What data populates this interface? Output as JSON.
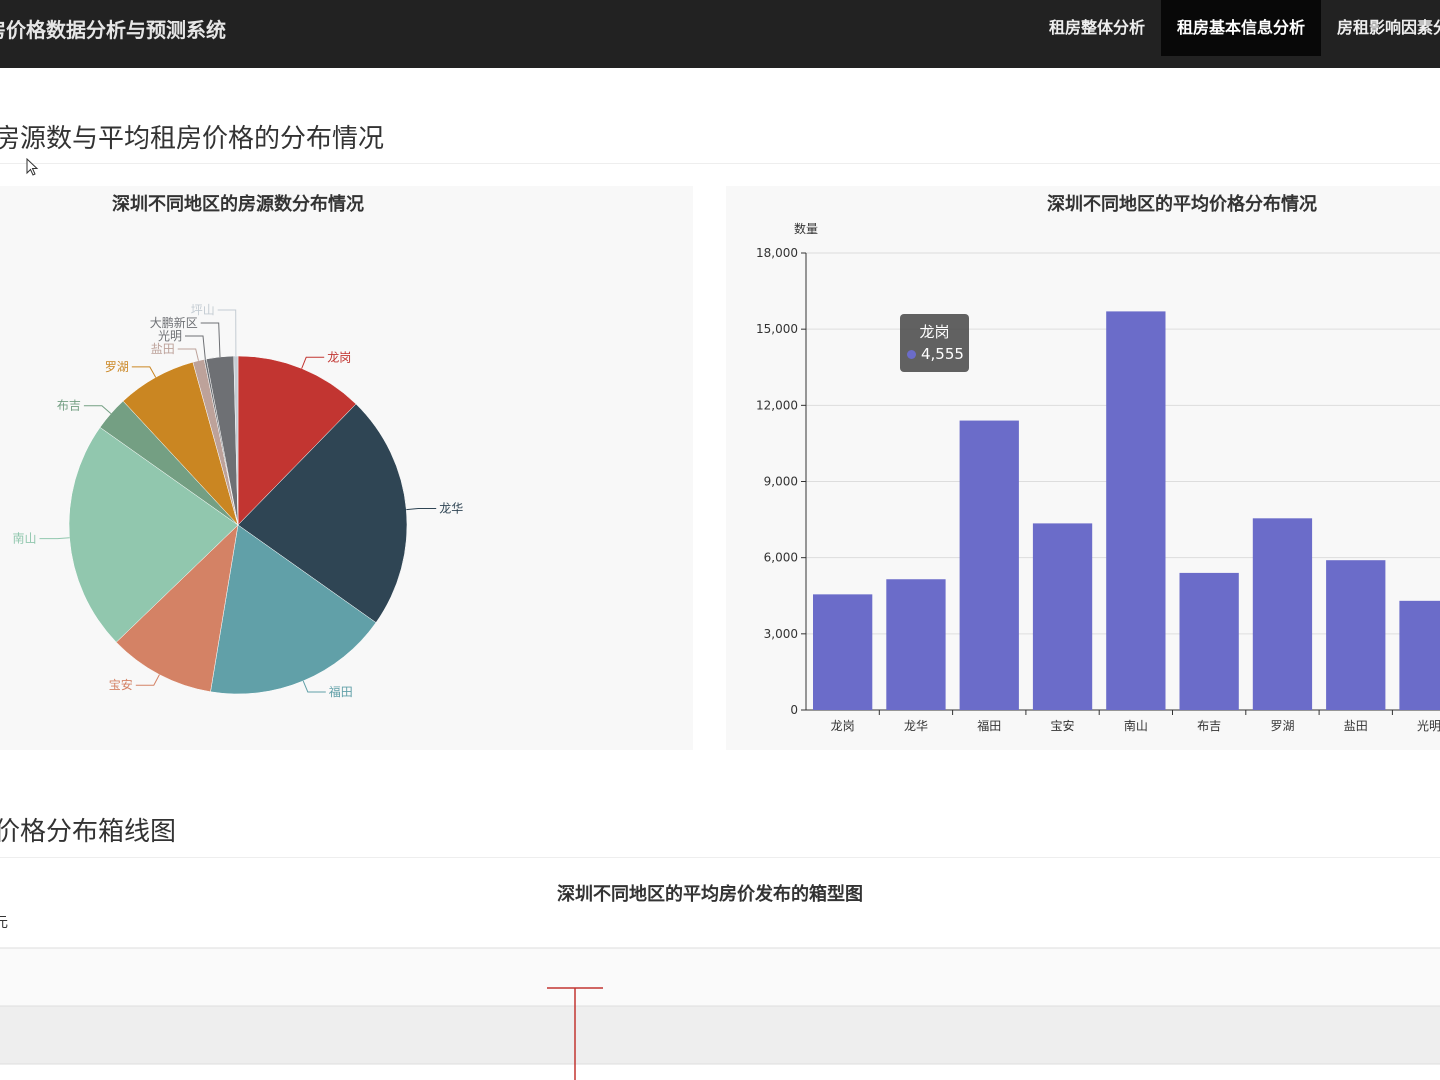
{
  "app": {
    "title": "房价格数据分析与预测系统",
    "nav": [
      {
        "label": "租房整体分析"
      },
      {
        "label": "租房基本信息分析"
      },
      {
        "label": "房租影响因素分"
      }
    ],
    "active_nav": 1
  },
  "section1": {
    "title": "房源数与平均租房价格的分布情况"
  },
  "section2": {
    "title": "价格分布箱线图"
  },
  "tooltip": {
    "name": "龙岗",
    "value": "4,555",
    "color": "#6b6cc9"
  },
  "chart_data": [
    {
      "type": "pie",
      "title": "深圳不同地区的房源数分布情况",
      "slices": [
        {
          "name": "龙岗",
          "value": 12.3,
          "color": "#c23531"
        },
        {
          "name": "龙华",
          "value": 22.5,
          "color": "#2f4554"
        },
        {
          "name": "福田",
          "value": 17.8,
          "color": "#61a0a8"
        },
        {
          "name": "宝安",
          "value": 10.2,
          "color": "#d48265"
        },
        {
          "name": "南山",
          "value": 22.0,
          "color": "#91c7ae"
        },
        {
          "name": "布吉",
          "value": 3.3,
          "color": "#749f83"
        },
        {
          "name": "罗湖",
          "value": 7.6,
          "color": "#ca8622"
        },
        {
          "name": "盐田",
          "value": 1.1,
          "color": "#bda29a"
        },
        {
          "name": "光明",
          "value": 0.2,
          "color": "#6e7074"
        },
        {
          "name": "大鹏新区",
          "value": 2.6,
          "color": "#6e7074"
        },
        {
          "name": "坪山",
          "value": 0.4,
          "color": "#c4ccd3"
        }
      ]
    },
    {
      "type": "bar",
      "title": "深圳不同地区的平均价格分布情况",
      "ylabel": "数量",
      "ylim": [
        0,
        18000
      ],
      "yticks": [
        "0",
        "3,000",
        "6,000",
        "9,000",
        "12,000",
        "15,000",
        "18,000"
      ],
      "categories": [
        "龙岗",
        "龙华",
        "福田",
        "宝安",
        "南山",
        "布吉",
        "罗湖",
        "盐田",
        "光明"
      ],
      "values": [
        4555,
        5150,
        11400,
        7350,
        15700,
        5400,
        7550,
        5900,
        4300
      ],
      "color": "#6b6cc9"
    },
    {
      "type": "box",
      "title": "深圳不同地区的平均房价发布的箱型图",
      "ylabel": "元",
      "color": "#c23531"
    }
  ]
}
